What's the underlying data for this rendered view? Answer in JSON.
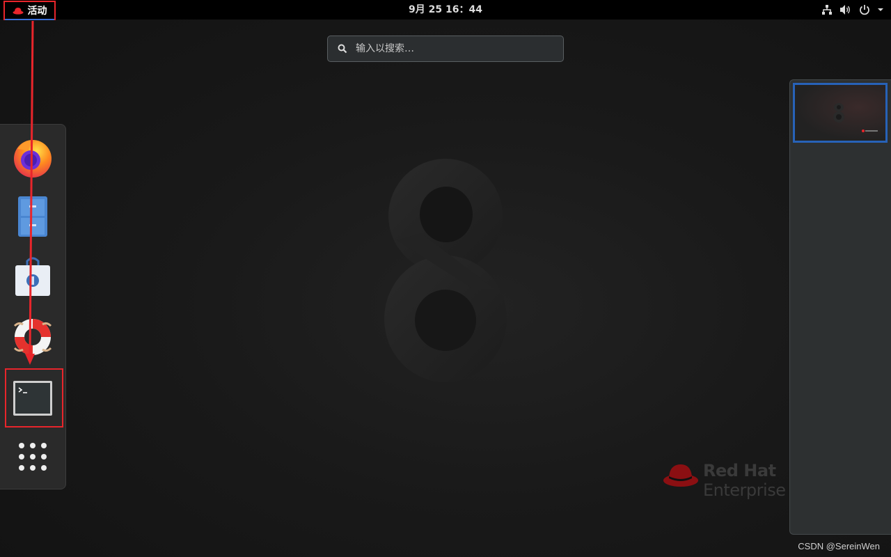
{
  "topbar": {
    "activities_label": "活动",
    "clock": "9月 25  16：44"
  },
  "search": {
    "placeholder": "输入以搜索…"
  },
  "dash": {
    "items": [
      {
        "name": "Firefox",
        "icon": "firefox-icon"
      },
      {
        "name": "Files",
        "icon": "file-cabinet-icon"
      },
      {
        "name": "Software",
        "icon": "software-bag-icon"
      },
      {
        "name": "Help",
        "icon": "lifebuoy-icon"
      },
      {
        "name": "Terminal",
        "icon": "terminal-icon"
      },
      {
        "name": "Show Applications",
        "icon": "app-grid-icon"
      }
    ]
  },
  "logo": {
    "line1": "Red Hat",
    "line2": "Enterprise"
  },
  "watermark": "CSDN @SereinWen",
  "colors": {
    "annotation_red": "#e8252b",
    "workspace_border": "#2762b8",
    "topbar_bg": "#000000",
    "dash_bg": "#2a2a2a"
  }
}
